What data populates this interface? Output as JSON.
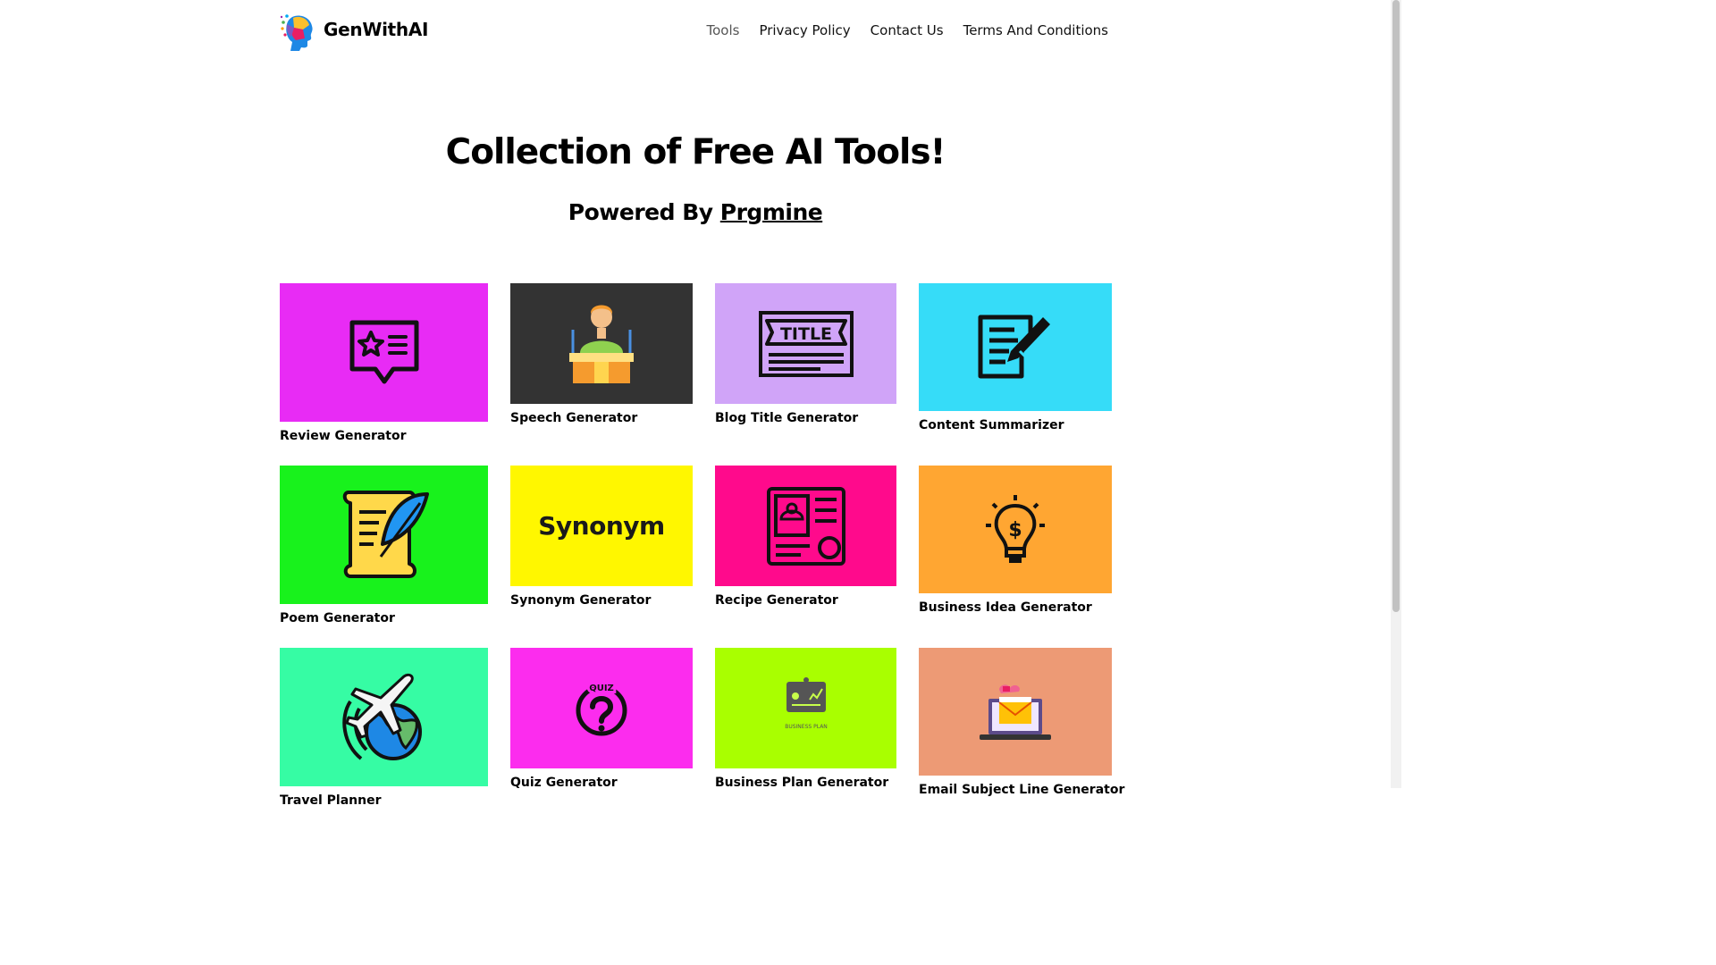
{
  "header": {
    "brand": "GenWithAI",
    "nav": [
      {
        "label": "Tools"
      },
      {
        "label": "Privacy Policy"
      },
      {
        "label": "Contact Us"
      },
      {
        "label": "Terms And Conditions"
      }
    ]
  },
  "hero": {
    "title": "Collection of Free AI Tools!",
    "powered_prefix": "Powered By ",
    "powered_link": "Prgmine"
  },
  "tools": [
    {
      "label": "Review Generator",
      "icon": "review-star-icon",
      "bg": "#e82bf5"
    },
    {
      "label": "Speech Generator",
      "icon": "speaker-podium-icon",
      "bg": "#333333"
    },
    {
      "label": "Blog Title Generator",
      "icon": "title-banner-icon",
      "bg": "#d0a4f8"
    },
    {
      "label": "Content Summarizer",
      "icon": "document-pencil-icon",
      "bg": "#36dcf8"
    },
    {
      "label": "Poem Generator",
      "icon": "scroll-quill-icon",
      "bg": "#18f21c"
    },
    {
      "label": "Synonym Generator",
      "icon": "synonym-word-icon",
      "icon_text": "Synonym",
      "bg": "#fff700"
    },
    {
      "label": "Recipe Generator",
      "icon": "recipe-book-icon",
      "bg": "#ff0a8c"
    },
    {
      "label": "Business Idea Generator",
      "icon": "lightbulb-dollar-icon",
      "bg": "#ffa632"
    },
    {
      "label": "Travel Planner",
      "icon": "airplane-globe-icon",
      "bg": "#36fca4"
    },
    {
      "label": "Quiz Generator",
      "icon": "quiz-question-icon",
      "icon_text": "QUIZ",
      "bg": "#fc2cee"
    },
    {
      "label": "Business Plan Generator",
      "icon": "business-plan-board-icon",
      "icon_text": "BUSINESS PLAN",
      "bg": "#a9ff00"
    },
    {
      "label": "Email Subject Line Generator",
      "icon": "laptop-email-icon",
      "bg": "#ed9a75"
    }
  ]
}
